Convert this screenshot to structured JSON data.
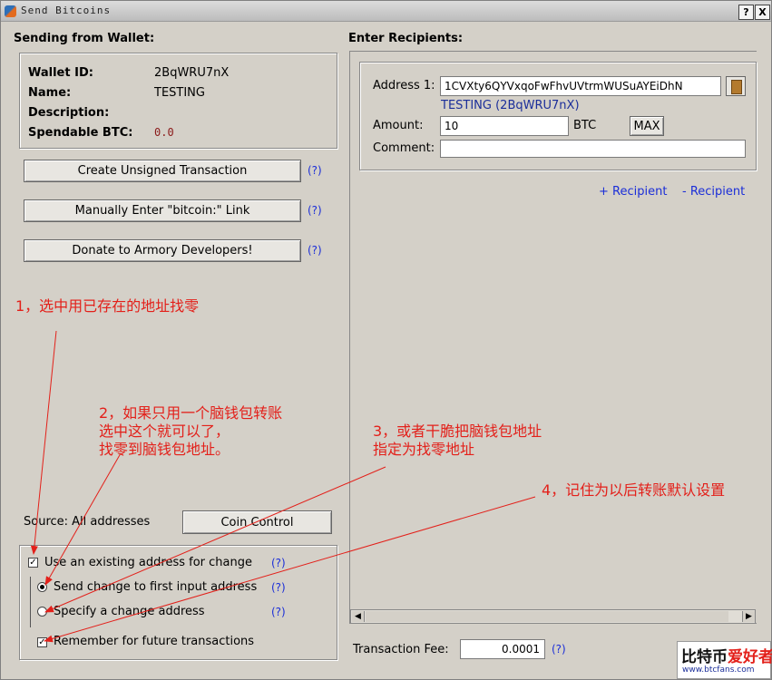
{
  "window": {
    "title": "Send Bitcoins",
    "help_btn": "?",
    "close_btn": "X"
  },
  "left": {
    "header": "Sending from Wallet:",
    "wallet_id_label": "Wallet ID:",
    "wallet_id": "2BqWRU7nX",
    "name_label": "Name:",
    "name": "TESTING",
    "desc_label": "Description:",
    "desc": "",
    "spendable_label": "Spendable BTC:",
    "spendable": "0.0",
    "btn_unsigned": "Create Unsigned Transaction",
    "btn_manual": "Manually Enter \"bitcoin:\" Link",
    "btn_donate": "Donate to Armory Developers!",
    "help": "(?)",
    "source_label": "Source: All addresses",
    "coin_control": "Coin Control",
    "chk_existing": "Use an existing address for change",
    "radio_first": "Send change to first input address",
    "radio_specify": "Specify a change address",
    "chk_remember": "Remember for future transactions"
  },
  "right": {
    "header": "Enter Recipients:",
    "address_label": "Address 1:",
    "address_value": "1CVXty6QYVxqoFwFhvUVtrmWUSuAYEiDhN",
    "address_owner": "TESTING (2BqWRU7nX)",
    "amount_label": "Amount:",
    "amount_value": "10",
    "btc_unit": "BTC",
    "max_btn": "MAX",
    "comment_label": "Comment:",
    "comment_value": "",
    "add_recipient": "+ Recipient",
    "remove_recipient": "- Recipient",
    "fee_label": "Transaction Fee:",
    "fee_value": "0.0001",
    "help": "(?)"
  },
  "annotations": {
    "a1": "1，选中用已存在的地址找零",
    "a2": "2，如果只用一个脑钱包转账\n选中这个就可以了，\n找零到脑钱包地址。",
    "a3": "3，或者干脆把脑钱包地址\n指定为找零地址",
    "a4": "4，记住为以后转账默认设置"
  },
  "watermark": {
    "line1a": "比特币",
    "line1b": "爱好者",
    "line2": "www.btcfans.com"
  }
}
